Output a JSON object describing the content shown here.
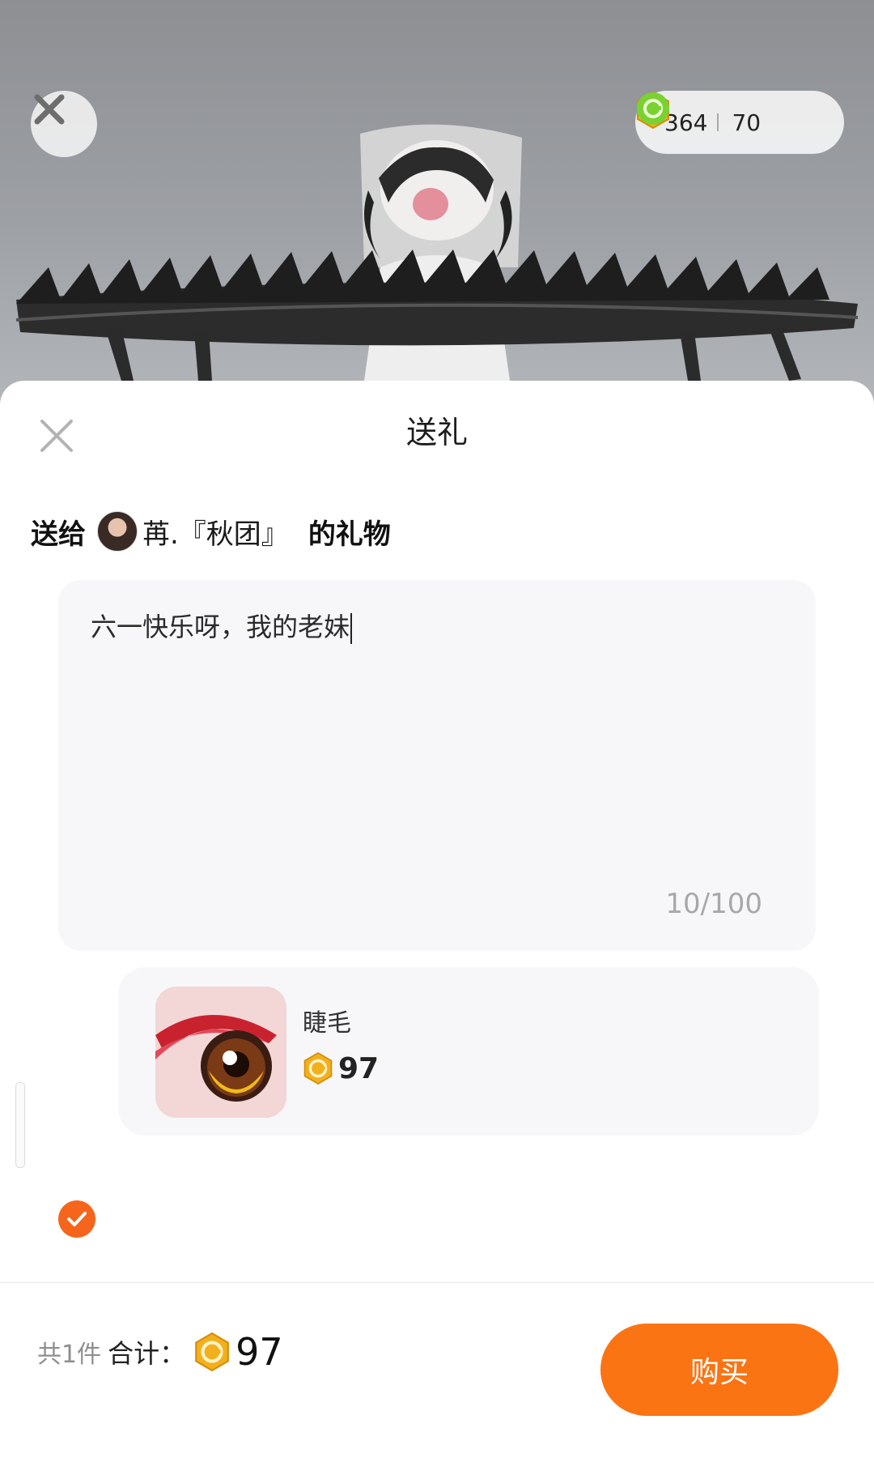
{
  "topbar": {
    "gold_coin_amount": "364",
    "green_coin_amount": "70",
    "close_icon": "close-icon",
    "gold_coin_icon": "gold-coin-icon",
    "green_coin_icon": "green-coin-icon"
  },
  "sheet": {
    "title": "送礼",
    "close_icon": "close-icon",
    "recipient": {
      "prefix": "送给",
      "name": "苒.『秋团』",
      "suffix": "的礼物"
    },
    "message": {
      "text": "六一快乐呀，我的老妹",
      "char_count": "10/100"
    },
    "gift": {
      "name": "睫毛",
      "price": "97",
      "selected": true,
      "thumb_icon": "eyelash-eye-icon"
    }
  },
  "footer": {
    "count_text": "共1件",
    "total_label": "合计：",
    "total_value": "97",
    "buy_label": "购买"
  },
  "colors": {
    "accent": "#fb7414",
    "check": "#f5651b",
    "gold": "#f2b01e",
    "green": "#7bd132"
  }
}
